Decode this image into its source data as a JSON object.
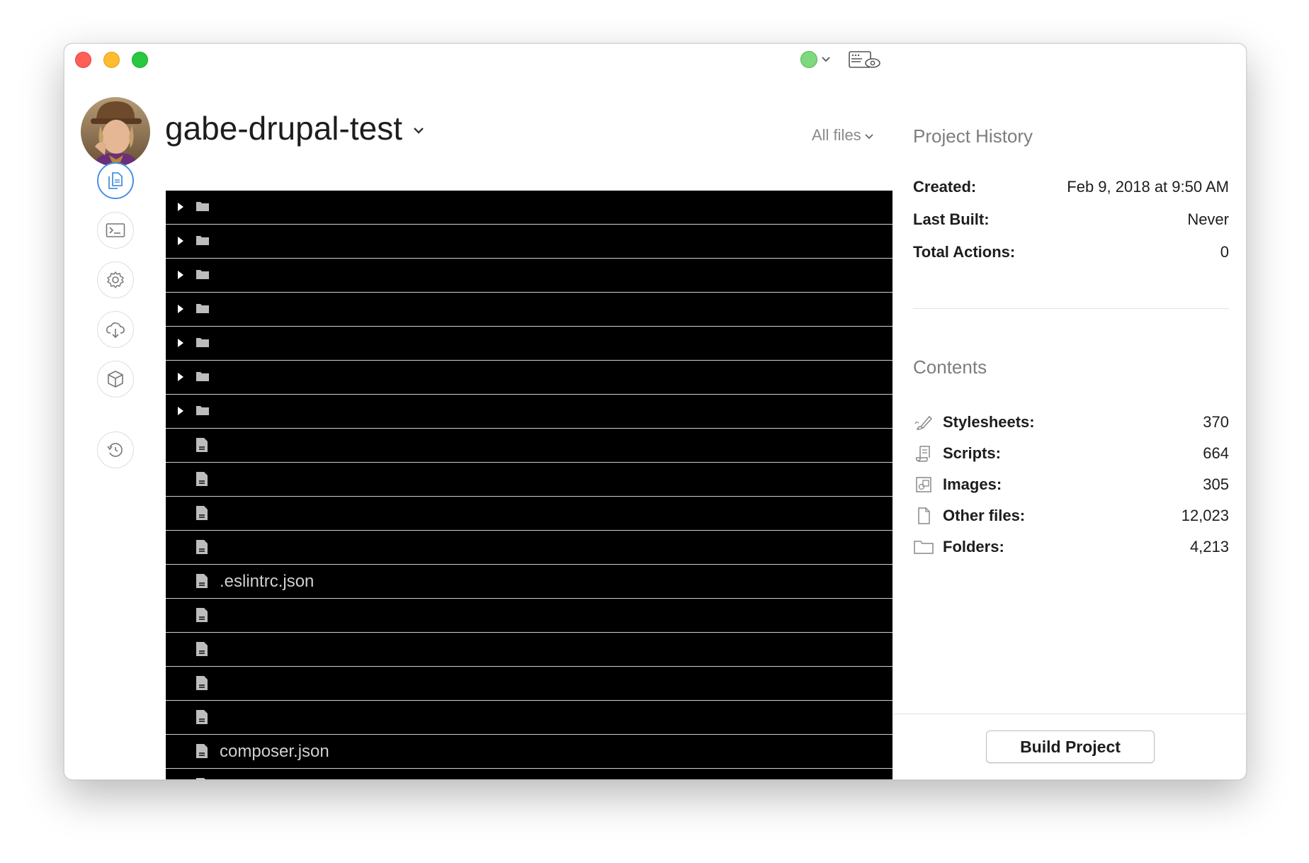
{
  "project": {
    "name": "gabe-drupal-test",
    "filter_label": "All files"
  },
  "toolbar": {
    "status_icon": "green-status-dot",
    "preview_icon": "browser-preview-eye-icon",
    "status_color": "#7ed97e"
  },
  "sidebar": {
    "tools": [
      {
        "name": "files-icon",
        "active": true
      },
      {
        "name": "terminal-icon",
        "active": false
      },
      {
        "name": "settings-gear-icon",
        "active": false
      },
      {
        "name": "cloud-download-icon",
        "active": false
      },
      {
        "name": "package-box-icon",
        "active": false
      },
      {
        "name": "history-refresh-icon",
        "active": false
      }
    ]
  },
  "files": [
    {
      "type": "folder",
      "name": ""
    },
    {
      "type": "folder",
      "name": ""
    },
    {
      "type": "folder",
      "name": ""
    },
    {
      "type": "folder",
      "name": ""
    },
    {
      "type": "folder",
      "name": ""
    },
    {
      "type": "folder",
      "name": ""
    },
    {
      "type": "folder",
      "name": ""
    },
    {
      "type": "file",
      "name": ""
    },
    {
      "type": "file",
      "name": ""
    },
    {
      "type": "file",
      "name": ""
    },
    {
      "type": "file",
      "name": ""
    },
    {
      "type": "file",
      "name": ".eslintrc.json"
    },
    {
      "type": "file",
      "name": ""
    },
    {
      "type": "file",
      "name": ""
    },
    {
      "type": "file",
      "name": ""
    },
    {
      "type": "file",
      "name": ""
    },
    {
      "type": "file",
      "name": "composer.json"
    },
    {
      "type": "file",
      "name": ""
    }
  ],
  "history": {
    "title": "Project History",
    "created_label": "Created:",
    "created_value": "Feb 9, 2018 at 9:50 AM",
    "last_built_label": "Last Built:",
    "last_built_value": "Never",
    "total_actions_label": "Total Actions:",
    "total_actions_value": "0"
  },
  "contents": {
    "title": "Contents",
    "items": [
      {
        "icon": "stylesheet-brush-icon",
        "label": "Stylesheets:",
        "value": "370"
      },
      {
        "icon": "script-scroll-icon",
        "label": "Scripts:",
        "value": "664"
      },
      {
        "icon": "image-icon",
        "label": "Images:",
        "value": "305"
      },
      {
        "icon": "document-icon",
        "label": "Other files:",
        "value": "12,023"
      },
      {
        "icon": "folder-icon",
        "label": "Folders:",
        "value": "4,213"
      }
    ]
  },
  "actions": {
    "build_label": "Build Project"
  }
}
